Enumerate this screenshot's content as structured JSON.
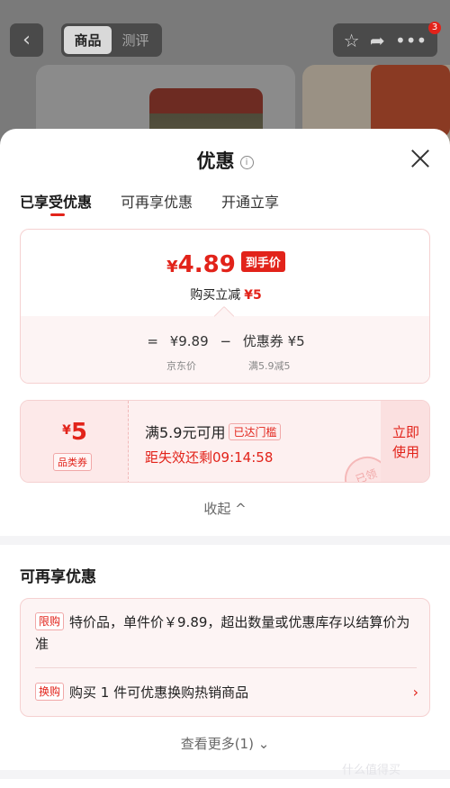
{
  "header": {
    "back_icon": "chevron-left-icon",
    "segments": [
      "商品",
      "测评"
    ],
    "active_segment": 0,
    "icons": [
      "star-icon",
      "share-icon",
      "more-icon"
    ],
    "badge_count": "3"
  },
  "sheet": {
    "title": "优惠",
    "info_icon": "i",
    "tabs": [
      "已享受优惠",
      "可再享优惠",
      "开通立享"
    ],
    "active_tab": 0
  },
  "price_card": {
    "currency": "¥",
    "price": "4.89",
    "price_tag": "到手价",
    "discount_label": "购买立减",
    "discount_amount": "¥5",
    "formula": {
      "equals": "=",
      "original": "¥9.89",
      "minus": "−",
      "coupon": "优惠券 ¥5"
    },
    "original_label": "京东价",
    "coupon_rule": "满5.9减5"
  },
  "coupon": {
    "currency": "¥",
    "amount": "5",
    "category": "品类券",
    "condition": "满5.9元可用",
    "reached": "已达门槛",
    "timer": "距失效还剩09:14:58",
    "use_line1": "立即",
    "use_line2": "使用",
    "stamp": "已领"
  },
  "collapse_label": "收起 ^",
  "more_section": {
    "title": "可再享优惠",
    "items": [
      {
        "tag": "限购",
        "text": "特价品，单件价￥9.89，超出数量或优惠库存以结算价为准"
      },
      {
        "tag": "换购",
        "text": "购买 1 件可优惠换购热销商品",
        "chevron": "›"
      }
    ],
    "see_more": "查看更多(1) ⌄"
  },
  "watermark": "什么值得买"
}
